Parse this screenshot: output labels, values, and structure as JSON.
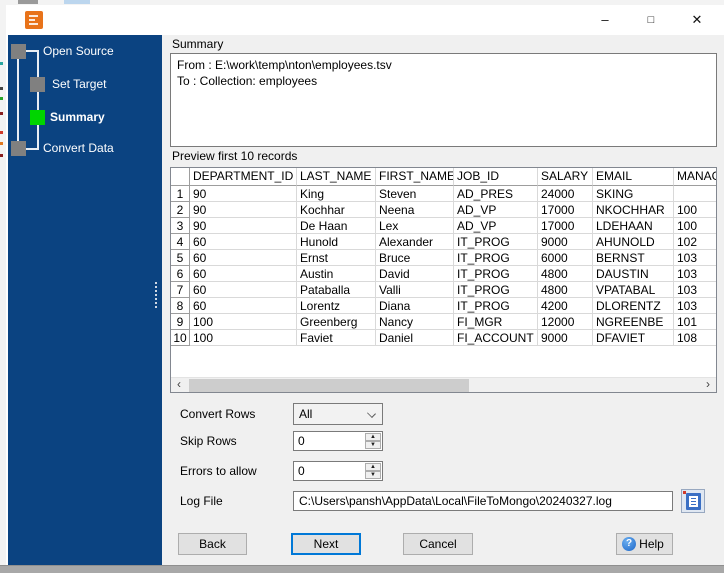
{
  "titlebar": {
    "minimize_glyph": "–",
    "maximize_glyph": "□",
    "close_glyph": "✕"
  },
  "sidebar": {
    "steps": [
      {
        "label": "Open Source",
        "state": "done"
      },
      {
        "label": "Set Target",
        "state": "done"
      },
      {
        "label": "Summary",
        "state": "active"
      },
      {
        "label": "Convert Data",
        "state": "pending"
      }
    ]
  },
  "summary": {
    "label": "Summary",
    "lines": [
      "From : E:\\work\\temp\\nton\\employees.tsv",
      "To : Collection: employees"
    ]
  },
  "preview": {
    "label": "Preview first 10 records"
  },
  "table": {
    "columns": [
      "",
      "DEPARTMENT_ID",
      "LAST_NAME",
      "FIRST_NAME",
      "JOB_ID",
      "SALARY",
      "EMAIL",
      "MANAG"
    ],
    "rows": [
      [
        "1",
        "90",
        "King",
        "Steven",
        "AD_PRES",
        "24000",
        "SKING",
        ""
      ],
      [
        "2",
        "90",
        "Kochhar",
        "Neena",
        "AD_VP",
        "17000",
        "NKOCHHAR",
        "100"
      ],
      [
        "3",
        "90",
        "De Haan",
        "Lex",
        "AD_VP",
        "17000",
        "LDEHAAN",
        "100"
      ],
      [
        "4",
        "60",
        "Hunold",
        "Alexander",
        "IT_PROG",
        "9000",
        "AHUNOLD",
        "102"
      ],
      [
        "5",
        "60",
        "Ernst",
        "Bruce",
        "IT_PROG",
        "6000",
        "BERNST",
        "103"
      ],
      [
        "6",
        "60",
        "Austin",
        "David",
        "IT_PROG",
        "4800",
        "DAUSTIN",
        "103"
      ],
      [
        "7",
        "60",
        "Pataballa",
        "Valli",
        "IT_PROG",
        "4800",
        "VPATABAL",
        "103"
      ],
      [
        "8",
        "60",
        "Lorentz",
        "Diana",
        "IT_PROG",
        "4200",
        "DLORENTZ",
        "103"
      ],
      [
        "9",
        "100",
        "Greenberg",
        "Nancy",
        "FI_MGR",
        "12000",
        "NGREENBE",
        "101"
      ],
      [
        "10",
        "100",
        "Faviet",
        "Daniel",
        "FI_ACCOUNT",
        "9000",
        "DFAVIET",
        "108"
      ]
    ]
  },
  "scrollbar": {
    "left_glyph": "‹",
    "right_glyph": "›"
  },
  "controls": {
    "convert_rows": {
      "label": "Convert Rows",
      "value": "All"
    },
    "skip_rows": {
      "label": "Skip Rows",
      "value": "0"
    },
    "errors_to_allow": {
      "label": "Errors to allow",
      "value": "0"
    },
    "log_file": {
      "label": "Log File",
      "value": "C:\\Users\\pansh\\AppData\\Local\\FileToMongo\\20240327.log"
    }
  },
  "spinner": {
    "up_glyph": "▲",
    "down_glyph": "▼"
  },
  "buttons": {
    "back": "Back",
    "next": "Next",
    "cancel": "Cancel",
    "help": "Help",
    "help_icon": "?"
  },
  "colors": {
    "sidebar_blue": "#0B4381",
    "active_step_green": "#00D500",
    "inactive_step_gray": "#808080",
    "accent_blue": "#0078D7",
    "app_icon_orange": "#E8731A"
  }
}
